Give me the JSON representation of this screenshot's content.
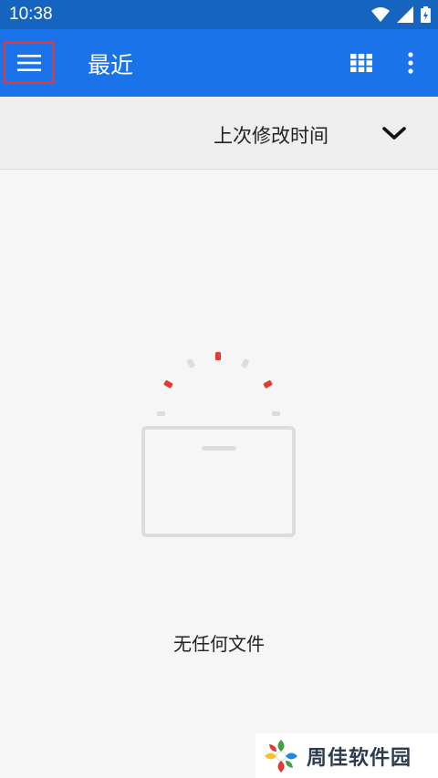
{
  "status_bar": {
    "time": "10:38",
    "icons": [
      "wifi-icon",
      "signal-icon",
      "battery-icon"
    ]
  },
  "app_bar": {
    "title": "最近",
    "icons": [
      "menu-icon",
      "grid-view-icon",
      "more-vert-icon"
    ]
  },
  "sort": {
    "label": "上次修改时间",
    "icon": "chevron-down-icon"
  },
  "empty_state": {
    "message": "无任何文件",
    "icon": "empty-folder-icon"
  },
  "watermark": {
    "text": "周佳软件园"
  },
  "colors": {
    "status_bar": "#1565c0",
    "app_bar": "#1a73e8",
    "accent_red": "#e53935",
    "background": "#f6f6f6"
  }
}
